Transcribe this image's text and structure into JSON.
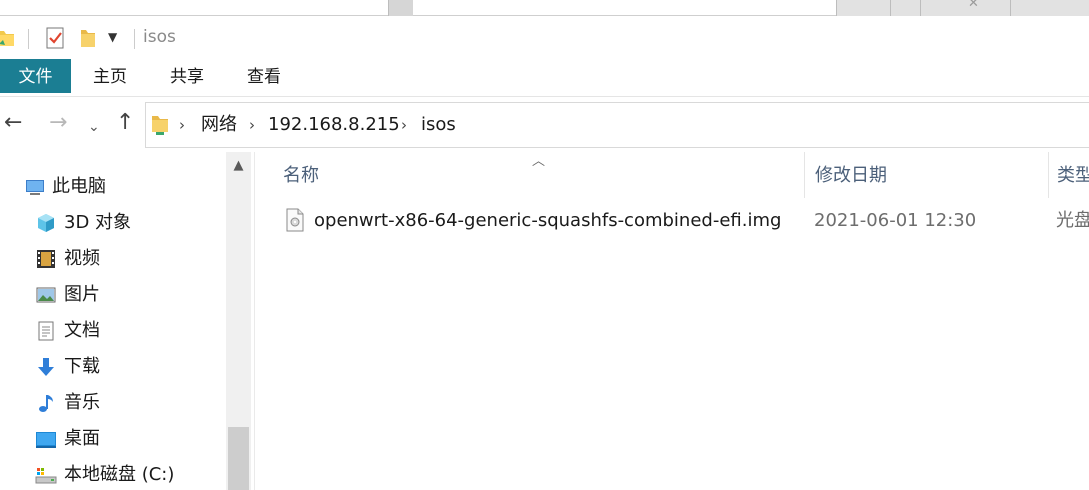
{
  "window": {
    "title": "isos"
  },
  "ribbon": {
    "tabs": [
      {
        "label": "文件"
      },
      {
        "label": "主页"
      },
      {
        "label": "共享"
      },
      {
        "label": "查看"
      }
    ]
  },
  "address": {
    "breadcrumbs": [
      "网络",
      "192.168.8.215",
      "isos"
    ]
  },
  "sidebar": {
    "items": [
      {
        "label": "此电脑",
        "icon": "computer-icon"
      },
      {
        "label": "3D 对象",
        "icon": "cube-icon"
      },
      {
        "label": "视频",
        "icon": "film-icon"
      },
      {
        "label": "图片",
        "icon": "picture-icon"
      },
      {
        "label": "文档",
        "icon": "document-icon"
      },
      {
        "label": "下载",
        "icon": "download-arrow-icon"
      },
      {
        "label": "音乐",
        "icon": "music-note-icon"
      },
      {
        "label": "桌面",
        "icon": "desktop-icon"
      },
      {
        "label": "本地磁盘 (C:)",
        "icon": "drive-icon"
      }
    ]
  },
  "columns": {
    "name": "名称",
    "date": "修改日期",
    "type": "类型"
  },
  "files": [
    {
      "name": "openwrt-x86-64-generic-squashfs-combined-efi.img",
      "date": "2021-06-01 12:30",
      "type": "光盘"
    }
  ],
  "colors": {
    "file_tab": "#1b7e93",
    "header_text": "#4c607a"
  }
}
